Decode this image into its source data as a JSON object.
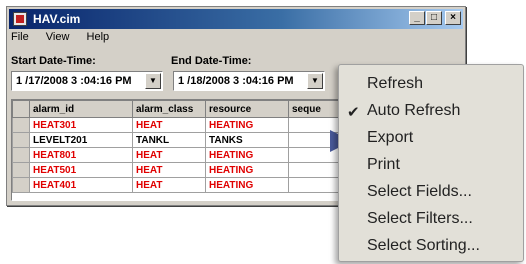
{
  "window": {
    "title": "HAV.cim",
    "buttons": {
      "minimize": "_",
      "maximize": "□",
      "close": "×"
    }
  },
  "menu": [
    "File",
    "View",
    "Help"
  ],
  "start": {
    "label": "Start Date-Time:",
    "value": "1 /17/2008  3 :04:16 PM"
  },
  "end": {
    "label": "End Date-Time:",
    "value": "1 /18/2008  3 :04:16 PM"
  },
  "table": {
    "columns": [
      "alarm_id",
      "alarm_class",
      "resource",
      "seque"
    ],
    "rows": [
      {
        "cells": [
          "HEAT301",
          "HEAT",
          "HEATING",
          ""
        ],
        "color": "#e00000"
      },
      {
        "cells": [
          "LEVELT201",
          "TANKL",
          "TANKS",
          ""
        ],
        "color": "#000000"
      },
      {
        "cells": [
          "HEAT801",
          "HEAT",
          "HEATING",
          ""
        ],
        "color": "#e00000"
      },
      {
        "cells": [
          "HEAT501",
          "HEAT",
          "HEATING",
          ""
        ],
        "color": "#e00000"
      },
      {
        "cells": [
          "HEAT401",
          "HEAT",
          "HEATING",
          ""
        ],
        "color": "#e00000"
      }
    ]
  },
  "context_menu": {
    "items": [
      "Refresh",
      "Auto Refresh",
      "Export",
      "Print",
      "Select Fields...",
      "Select Filters...",
      "Select Sorting..."
    ],
    "checked": "Auto Refresh",
    "check_glyph": "✔"
  }
}
